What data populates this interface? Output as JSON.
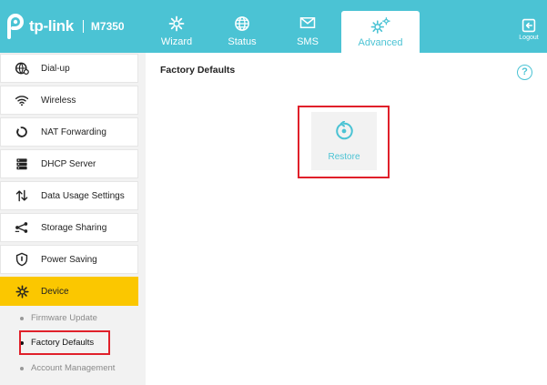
{
  "brand": {
    "name": "tp-link",
    "model": "M7350"
  },
  "colors": {
    "accent": "#4bc3d4",
    "active_side": "#fbc700",
    "highlight": "#e0202a"
  },
  "nav": {
    "tabs": [
      {
        "label": "Wizard",
        "icon": "gear-icon"
      },
      {
        "label": "Status",
        "icon": "globe-icon"
      },
      {
        "label": "SMS",
        "icon": "envelope-icon"
      },
      {
        "label": "Advanced",
        "icon": "gears-icon",
        "active": true
      }
    ],
    "logout_label": "Logout"
  },
  "sidebar": {
    "items": [
      {
        "label": "Dial-up",
        "icon": "globe-settings-icon"
      },
      {
        "label": "Wireless",
        "icon": "wifi-icon"
      },
      {
        "label": "NAT Forwarding",
        "icon": "nat-icon"
      },
      {
        "label": "DHCP Server",
        "icon": "server-icon"
      },
      {
        "label": "Data Usage Settings",
        "icon": "data-arrows-icon"
      },
      {
        "label": "Storage Sharing",
        "icon": "share-icon"
      },
      {
        "label": "Power Saving",
        "icon": "shield-icon"
      },
      {
        "label": "Device",
        "icon": "gear-icon",
        "active": true
      }
    ],
    "sub_items": [
      {
        "label": "Firmware Update"
      },
      {
        "label": "Factory Defaults",
        "current": true
      },
      {
        "label": "Account Management"
      }
    ]
  },
  "main": {
    "title": "Factory Defaults",
    "help_label": "?",
    "restore_label": "Restore"
  }
}
